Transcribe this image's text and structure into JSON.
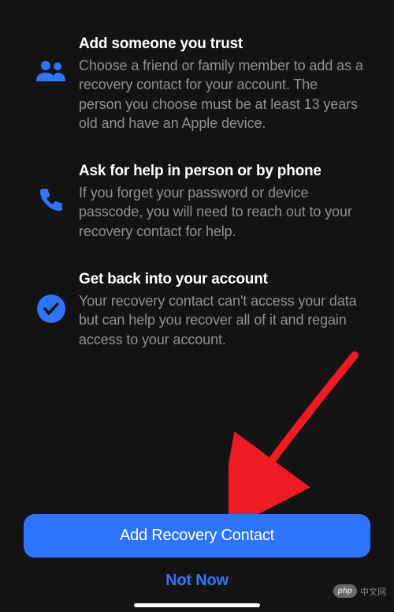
{
  "sections": [
    {
      "icon": "people-icon",
      "title": "Add someone you trust",
      "desc": "Choose a friend or family member to add as a recovery contact for your account. The person you choose must be at least 13 years old and have an Apple device."
    },
    {
      "icon": "phone-icon",
      "title": "Ask for help in person or by phone",
      "desc": "If you forget your password or device passcode, you will need to reach out to your recovery contact for help."
    },
    {
      "icon": "checkmark-circle-icon",
      "title": "Get back into your account",
      "desc": "Your recovery contact can't access your data but can help you recover all of it and regain access to your account."
    }
  ],
  "buttons": {
    "primary": "Add Recovery Contact",
    "secondary": "Not Now"
  },
  "colors": {
    "accent": "#2e74ff",
    "background": "#141414",
    "mutedText": "#8f8f93"
  },
  "watermark": {
    "badge": "php",
    "text": "中文网"
  }
}
